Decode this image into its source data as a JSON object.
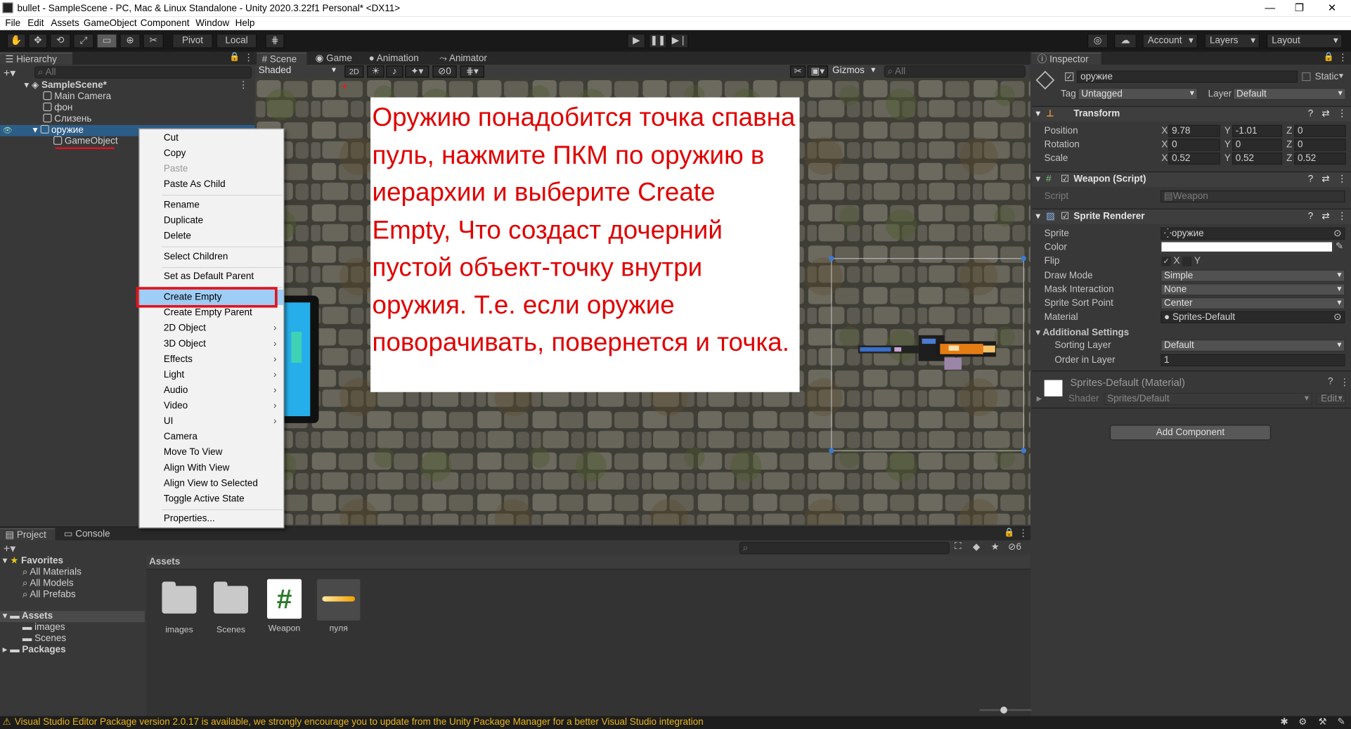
{
  "window": {
    "title": "bullet - SampleScene - PC, Mac & Linux Standalone - Unity 2020.3.22f1 Personal* <DX11>",
    "minimize": "—",
    "maximize": "❐",
    "close": "✕"
  },
  "menu": [
    "File",
    "Edit",
    "Assets",
    "GameObject",
    "Component",
    "Window",
    "Help"
  ],
  "toolbar": {
    "pivot": "Pivot",
    "local": "Local",
    "account": "Account",
    "layers": "Layers",
    "layout": "Layout"
  },
  "hierarchy": {
    "tab": "Hierarchy",
    "search_placeholder": "All",
    "items": [
      {
        "label": "SampleScene*"
      },
      {
        "label": "Main Camera"
      },
      {
        "label": "фон"
      },
      {
        "label": "Слизень"
      },
      {
        "label": "оружие"
      },
      {
        "label": "GameObject"
      }
    ]
  },
  "context_menu": {
    "items": [
      "Cut",
      "Copy",
      "Paste",
      "Paste As Child",
      "Rename",
      "Duplicate",
      "Delete",
      "Select Children",
      "Set as Default Parent",
      "Create Empty",
      "Create Empty Parent",
      "2D Object",
      "3D Object",
      "Effects",
      "Light",
      "Audio",
      "Video",
      "UI",
      "Camera",
      "Move To View",
      "Align With View",
      "Align View to Selected",
      "Toggle Active State",
      "Properties..."
    ]
  },
  "scene_tabs": {
    "scene": "Scene",
    "game": "Game",
    "animation": "Animation",
    "animator": "Animator",
    "shaded": "Shaded",
    "mode_2d": "2D",
    "hidden_count": "0",
    "gizmos": "Gizmos",
    "search_placeholder": "All"
  },
  "overlay_text": "Оружию понадобится точка спавна пуль, нажмите ПКМ по оружию в иерархии и выберите Create Empty, Что создаст дочерний пустой объект-точку внутри оружия. Т.е. если оружие поворачивать, повернется и точка.",
  "inspector": {
    "tab": "Inspector",
    "object_name": "оружие",
    "static": "Static",
    "tag_label": "Tag",
    "tag_value": "Untagged",
    "layer_label": "Layer",
    "layer_value": "Default",
    "transform": {
      "title": "Transform",
      "position_label": "Position",
      "rotation_label": "Rotation",
      "scale_label": "Scale",
      "position": [
        "9.78",
        "-1.01",
        "0"
      ],
      "rotation": [
        "0",
        "0",
        "0"
      ],
      "scale": [
        "0.52",
        "0.52",
        "0.52"
      ],
      "axis_x": "X",
      "axis_y": "Y",
      "axis_z": "Z"
    },
    "weapon_script": {
      "title": "Weapon (Script)",
      "script_label": "Script",
      "script_value": "Weapon"
    },
    "sprite_renderer": {
      "title": "Sprite Renderer",
      "sprite_label": "Sprite",
      "sprite_value": "оружие",
      "color_label": "Color",
      "color_value": "#ffffff",
      "flip_label": "Flip",
      "flip_x": "X",
      "flip_y": "Y",
      "draw_mode_label": "Draw Mode",
      "draw_mode_value": "Simple",
      "mask_label": "Mask Interaction",
      "mask_value": "None",
      "sort_point_label": "Sprite Sort Point",
      "sort_point_value": "Center",
      "material_label": "Material",
      "material_value": "Sprites-Default",
      "additional": "Additional Settings",
      "sorting_layer_label": "Sorting Layer",
      "sorting_layer_value": "Default",
      "order_label": "Order in Layer",
      "order_value": "1"
    },
    "material": {
      "title": "Sprites-Default (Material)",
      "shader_label": "Shader",
      "shader_value": "Sprites/Default",
      "edit": "Edit..."
    },
    "add_component": "Add Component"
  },
  "project": {
    "tab_project": "Project",
    "tab_console": "Console",
    "hidden_count": "6",
    "favorites": "Favorites",
    "fav_items": [
      "All Materials",
      "All Models",
      "All Prefabs"
    ],
    "assets": "Assets",
    "asset_folders": [
      "images",
      "Scenes"
    ],
    "packages": "Packages",
    "breadcrumb": "Assets",
    "grid": [
      "images",
      "Scenes",
      "Weapon",
      "пуля"
    ],
    "script_glyph": "#"
  },
  "status": {
    "message": "Visual Studio Editor Package version 2.0.17 is available, we strongly encourage you to update from the Unity Package Manager for a better Visual Studio integration"
  },
  "colors": {
    "selection": "#2c5d87",
    "overlay_text": "#e00000",
    "highlight_box": "#e0141e",
    "menu_highlight": "#9ecdf5",
    "warning": "#e8b51a"
  }
}
